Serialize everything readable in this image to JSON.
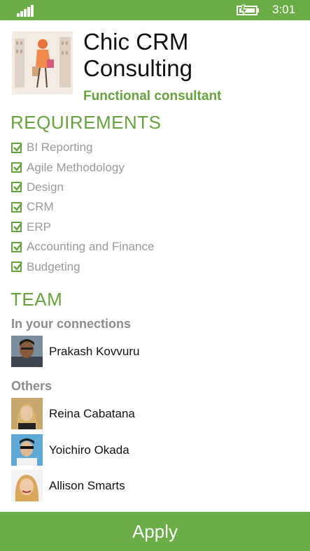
{
  "status": {
    "time": "3:01"
  },
  "header": {
    "company_name": "Chic CRM Consulting",
    "role": "Functional consultant"
  },
  "requirements": {
    "heading": "REQUIREMENTS",
    "items": [
      {
        "label": "BI Reporting",
        "checked": true
      },
      {
        "label": "Agile Methodology",
        "checked": true
      },
      {
        "label": "Design",
        "checked": true
      },
      {
        "label": "CRM",
        "checked": true
      },
      {
        "label": "ERP",
        "checked": true
      },
      {
        "label": "Accounting and Finance",
        "checked": true
      },
      {
        "label": "Budgeting",
        "checked": true
      }
    ]
  },
  "team": {
    "heading": "TEAM",
    "connections_label": "In your connections",
    "connections": [
      {
        "name": "Prakash Kovvuru"
      }
    ],
    "others_label": "Others",
    "others": [
      {
        "name": "Reina Cabatana"
      },
      {
        "name": "Yoichiro Okada"
      },
      {
        "name": "Allison Smarts"
      }
    ]
  },
  "apply_label": "Apply",
  "colors": {
    "accent": "#6aac46",
    "accent_text": "#66a33f",
    "muted": "#9a9a9a"
  }
}
